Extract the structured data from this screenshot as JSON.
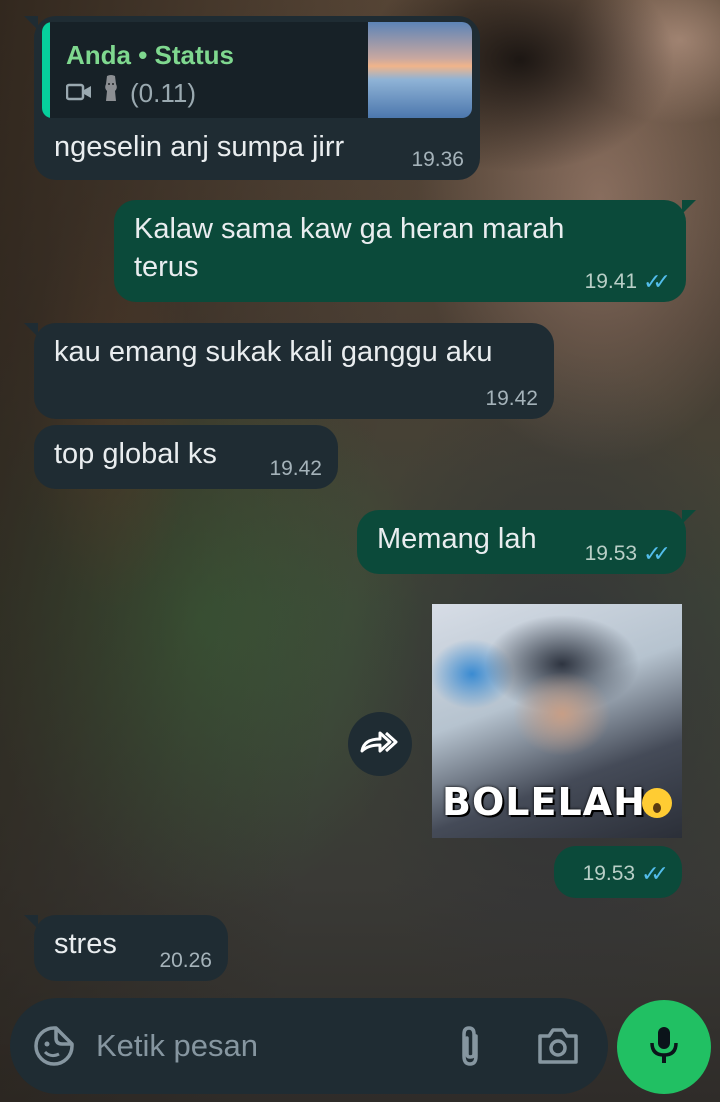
{
  "colors": {
    "incoming_bubble": "#1f2c33",
    "outgoing_bubble": "#0b4a3a",
    "read_ticks": "#53bdeb",
    "accent_green": "#21c063",
    "quote_title": "#7fd88f"
  },
  "messages": [
    {
      "direction": "incoming",
      "reply_to": {
        "title": "Anda • Status",
        "meta": "(0.11)",
        "icons": [
          "video-icon",
          "statue-emoji-icon"
        ]
      },
      "text": "ngeselin anj sumpa jirr",
      "time": "19.36"
    },
    {
      "direction": "outgoing",
      "text": "Kalaw sama kaw ga heran marah terus",
      "time": "19.41",
      "ticks": "✓✓"
    },
    {
      "direction": "incoming",
      "text": "kau emang sukak kali ganggu aku",
      "time": "19.42"
    },
    {
      "direction": "incoming",
      "text": "top global ks",
      "time": "19.42"
    },
    {
      "direction": "outgoing",
      "text": "Memang lah",
      "time": "19.53",
      "ticks": "✓✓"
    },
    {
      "direction": "outgoing",
      "type": "sticker",
      "sticker_text": "BOLELAH",
      "time": "19.53",
      "ticks": "✓✓"
    },
    {
      "direction": "incoming",
      "text": "stres",
      "time": "20.26"
    }
  ],
  "composer": {
    "placeholder": "Ketik pesan",
    "icons": [
      "sticker-icon",
      "attach-icon",
      "camera-icon",
      "mic-icon"
    ]
  }
}
